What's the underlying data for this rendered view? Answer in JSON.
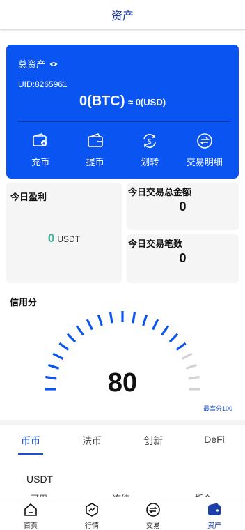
{
  "header": {
    "title": "资产"
  },
  "asset_card": {
    "label": "总资产",
    "uid": "UID:8265961",
    "btc_value": "0(BTC)",
    "usd_value": "≈ 0(USD)",
    "actions": [
      {
        "label": "充币",
        "icon": "deposit-icon"
      },
      {
        "label": "提币",
        "icon": "wallet-icon"
      },
      {
        "label": "划转",
        "icon": "transfer-icon"
      },
      {
        "label": "交易明细",
        "icon": "exchange-detail-icon"
      }
    ]
  },
  "profit": {
    "title": "今日盈利",
    "value": "0",
    "unit": "USDT"
  },
  "trade_amount": {
    "title": "今日交易总金额",
    "value": "0"
  },
  "trade_count": {
    "title": "今日交易笔数",
    "value": "0"
  },
  "credit": {
    "title": "信用分",
    "score": "80",
    "max_label": "最高分100",
    "score_value": 80,
    "max_value": 100,
    "active_color": "#0a55f2",
    "inactive_color": "#d3d3d3"
  },
  "tabs": [
    {
      "label": "币币",
      "active": true
    },
    {
      "label": "法币",
      "active": false
    },
    {
      "label": "创新",
      "active": false
    },
    {
      "label": "DeFi",
      "active": false
    }
  ],
  "coin": {
    "name": "USDT",
    "columns": [
      "可用",
      "冻结",
      "折合"
    ]
  },
  "tabbar": [
    {
      "label": "首页",
      "icon": "home-icon",
      "active": false
    },
    {
      "label": "行情",
      "icon": "market-icon",
      "active": false
    },
    {
      "label": "交易",
      "icon": "trade-icon",
      "active": false
    },
    {
      "label": "资产",
      "icon": "assets-icon",
      "active": true
    }
  ],
  "colors": {
    "primary": "#0a55f2",
    "header_title": "#1b3fa6",
    "profit_green": "#3ab59a"
  }
}
